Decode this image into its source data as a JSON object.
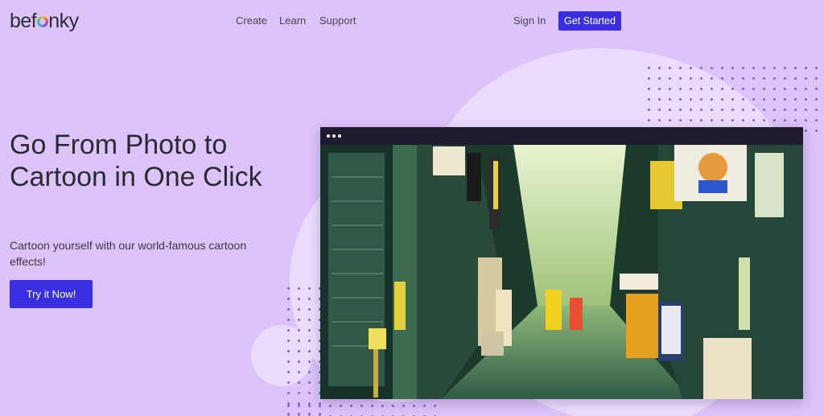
{
  "header": {
    "logo": {
      "before": "bef",
      "after": "nky"
    },
    "nav": [
      "Create",
      "Learn",
      "Support"
    ],
    "sign_in": "Sign In",
    "get_started": "Get Started"
  },
  "hero": {
    "title": "Go From Photo to Cartoon in One Click",
    "subtitle": "Cartoon yourself with our world-famous cartoon effects!",
    "cta": "Try it Now!"
  },
  "preview": {
    "icons": [
      "more-dots-icon"
    ],
    "colors": {
      "accent": "#3a2fe0",
      "background": "#dcc3f9",
      "blob": "#ecdcfc",
      "window": "#1e1b2e"
    }
  }
}
